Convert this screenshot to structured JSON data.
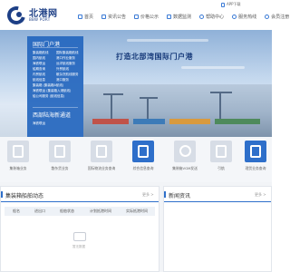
{
  "header": {
    "logo_cn": "北港网",
    "logo_en": "BBW PORT",
    "app_download": "APP下载",
    "nav": [
      {
        "label": "首页",
        "icon": "home-icon"
      },
      {
        "label": "资讯公告",
        "icon": "news-icon"
      },
      {
        "label": "价格公示",
        "icon": "price-icon"
      },
      {
        "label": "数据监测",
        "icon": "monitor-icon"
      },
      {
        "label": "帮助中心",
        "icon": "help-icon"
      },
      {
        "label": "服务热线",
        "icon": "phone-icon"
      },
      {
        "label": "会员注册",
        "icon": "user-icon"
      }
    ]
  },
  "banner": {
    "title": "打造北部湾国际门户港"
  },
  "side_panel": {
    "title": "国际门户港",
    "items": [
      [
        "集装箱航线",
        "国际集装箱航线"
      ],
      [
        "国内航线",
        "港口作业服务"
      ],
      [
        "海铁联运",
        "远洋航线服务"
      ],
      [
        "船期查询",
        "外贸航线"
      ],
      [
        "内贸航线",
        "散杂货航线服务"
      ],
      [
        "航线信息",
        "港口服务"
      ],
      [
        "集装箱 (集装箱A航线)",
        ""
      ],
      [
        "海铁联运 (集装箱入港航线)",
        ""
      ],
      [
        "船公司服务 (航线信息)",
        ""
      ]
    ],
    "title2": "西部陆海新通道",
    "sub": "海铁联运"
  },
  "services": [
    {
      "label": "集装箱业务",
      "style": "gray"
    },
    {
      "label": "散杂货业务",
      "style": "gray"
    },
    {
      "label": "国际物流业务查询",
      "style": "gray"
    },
    {
      "label": "综合信息查询",
      "style": "blue"
    },
    {
      "label": "集装箱VGM发送",
      "style": "gray"
    },
    {
      "label": "引航",
      "style": "gray"
    },
    {
      "label": "理货业务查询",
      "style": "blue"
    }
  ],
  "left_card": {
    "title": "集装箱船舶动态",
    "more": "更多 >",
    "columns": [
      "船名",
      "进出口",
      "船舶状态",
      "计划抵港时间",
      "实际抵港时间"
    ],
    "empty_text": "暂无数据"
  },
  "right_card": {
    "title": "新闻资讯",
    "more": "更多 >"
  }
}
